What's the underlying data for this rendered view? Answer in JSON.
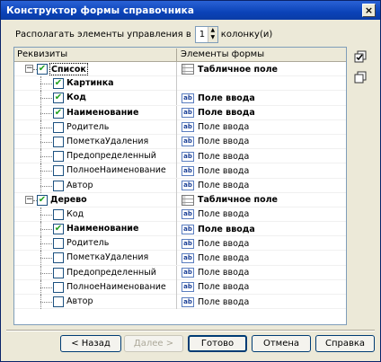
{
  "window": {
    "title": "Конструктор формы справочника",
    "close": "×"
  },
  "columns_setting": {
    "prefix": "Располагать элементы управления в",
    "value": "1",
    "suffix": "колонку(и)"
  },
  "grid": {
    "headers": [
      "Реквизиты",
      "Элементы формы"
    ],
    "rows": [
      {
        "label": "Список",
        "checked": true,
        "bold": true,
        "level": 0,
        "expand": "−",
        "element": "Табличное поле",
        "icon": "table",
        "element_bold": true,
        "selected": true
      },
      {
        "label": "Картинка",
        "checked": true,
        "bold": true,
        "level": 1,
        "element": "",
        "icon": ""
      },
      {
        "label": "Код",
        "checked": true,
        "bold": true,
        "level": 1,
        "element": "Поле ввода",
        "icon": "ab",
        "element_bold": true
      },
      {
        "label": "Наименование",
        "checked": true,
        "bold": true,
        "level": 1,
        "element": "Поле ввода",
        "icon": "ab",
        "element_bold": true
      },
      {
        "label": "Родитель",
        "checked": false,
        "bold": false,
        "level": 1,
        "element": "Поле ввода",
        "icon": "ab"
      },
      {
        "label": "ПометкаУдаления",
        "checked": false,
        "bold": false,
        "level": 1,
        "element": "Поле ввода",
        "icon": "ab"
      },
      {
        "label": "Предопределенный",
        "checked": false,
        "bold": false,
        "level": 1,
        "element": "Поле ввода",
        "icon": "ab"
      },
      {
        "label": "ПолноеНаименование",
        "checked": false,
        "bold": false,
        "level": 1,
        "element": "Поле ввода",
        "icon": "ab"
      },
      {
        "label": "Автор",
        "checked": false,
        "bold": false,
        "level": 1,
        "element": "Поле ввода",
        "icon": "ab"
      },
      {
        "label": "Дерево",
        "checked": true,
        "bold": true,
        "level": 0,
        "expand": "−",
        "element": "Табличное поле",
        "icon": "table",
        "element_bold": true
      },
      {
        "label": "Код",
        "checked": false,
        "bold": false,
        "level": 1,
        "element": "Поле ввода",
        "icon": "ab"
      },
      {
        "label": "Наименование",
        "checked": true,
        "bold": true,
        "level": 1,
        "element": "Поле ввода",
        "icon": "ab",
        "element_bold": true
      },
      {
        "label": "Родитель",
        "checked": false,
        "bold": false,
        "level": 1,
        "element": "Поле ввода",
        "icon": "ab"
      },
      {
        "label": "ПометкаУдаления",
        "checked": false,
        "bold": false,
        "level": 1,
        "element": "Поле ввода",
        "icon": "ab"
      },
      {
        "label": "Предопределенный",
        "checked": false,
        "bold": false,
        "level": 1,
        "element": "Поле ввода",
        "icon": "ab"
      },
      {
        "label": "ПолноеНаименование",
        "checked": false,
        "bold": false,
        "level": 1,
        "element": "Поле ввода",
        "icon": "ab"
      },
      {
        "label": "Автор",
        "checked": false,
        "bold": false,
        "level": 1,
        "element": "Поле ввода",
        "icon": "ab"
      }
    ]
  },
  "side_icons": [
    "check-all-icon",
    "uncheck-all-icon"
  ],
  "buttons": {
    "back": "< Назад",
    "next": "Далее >",
    "done": "Готово",
    "cancel": "Отмена",
    "help": "Справка"
  }
}
